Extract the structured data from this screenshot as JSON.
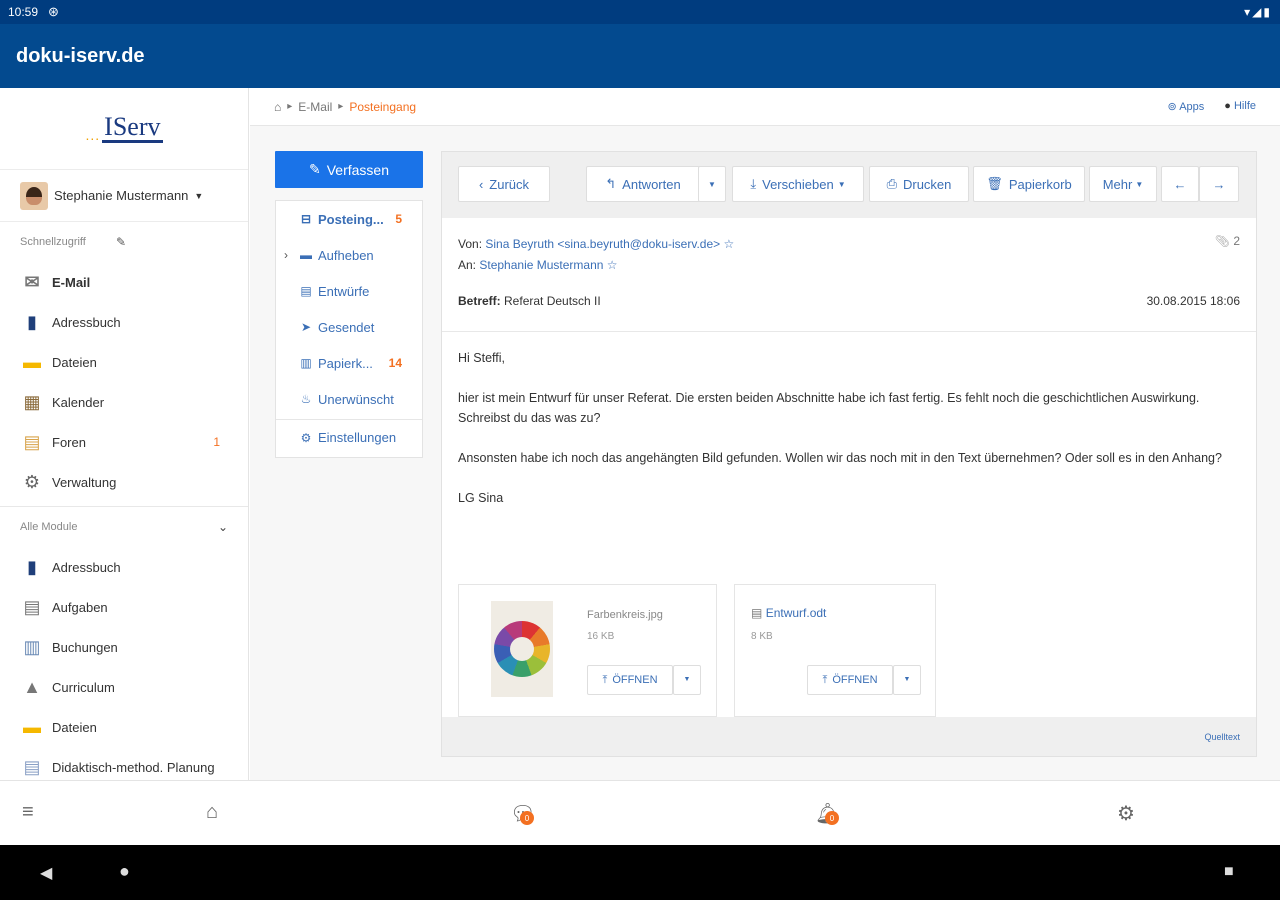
{
  "status_bar": {
    "time": "10:59",
    "signal_icons": "▾◢▮"
  },
  "app_bar": {
    "title": "doku-iserv.de"
  },
  "sidebar": {
    "logo_text": "IServ",
    "logo_dots": "...",
    "user_name": "Stephanie Mustermann",
    "quick_access_label": "Schnellzugriff",
    "quick_items": [
      {
        "label": "E-Mail",
        "icon": "envelope-icon"
      },
      {
        "label": "Adressbuch",
        "icon": "addressbook-icon"
      },
      {
        "label": "Dateien",
        "icon": "folder-icon"
      },
      {
        "label": "Kalender",
        "icon": "calendar-icon"
      },
      {
        "label": "Foren",
        "icon": "forum-icon",
        "badge": "1"
      },
      {
        "label": "Verwaltung",
        "icon": "gear-icon"
      }
    ],
    "all_modules_label": "Alle Module",
    "module_items": [
      {
        "label": "Adressbuch",
        "icon": "addressbook-icon"
      },
      {
        "label": "Aufgaben",
        "icon": "tasks-icon"
      },
      {
        "label": "Buchungen",
        "icon": "booking-icon"
      },
      {
        "label": "Curriculum",
        "icon": "curriculum-icon"
      },
      {
        "label": "Dateien",
        "icon": "folder-icon"
      },
      {
        "label": "Didaktisch-method. Planung",
        "icon": "document-icon"
      }
    ]
  },
  "breadcrumb": {
    "home": "home-icon",
    "email": "E-Mail",
    "current": "Posteingang",
    "apps": "Apps",
    "help": "Hilfe"
  },
  "compose_label": "Verfassen",
  "folders": [
    {
      "label": "Posteing...",
      "count": "5",
      "icon": "inbox-icon",
      "active": true
    },
    {
      "label": "Aufheben",
      "count": "",
      "icon": "folder-icon"
    },
    {
      "label": "Entwürfe",
      "count": "",
      "icon": "drafts-icon"
    },
    {
      "label": "Gesendet",
      "count": "",
      "icon": "sent-icon"
    },
    {
      "label": "Papierk...",
      "count": "14",
      "icon": "trash-icon"
    },
    {
      "label": "Unerwünscht",
      "count": "",
      "icon": "spam-icon"
    }
  ],
  "settings_label": "Einstellungen",
  "toolbar": {
    "back": "Zurück",
    "reply": "Antworten",
    "move": "Verschieben",
    "print": "Drucken",
    "trash": "Papierkorb",
    "more": "Mehr"
  },
  "mail": {
    "from_label": "Von:",
    "from": "Sina Beyruth <sina.beyruth@doku-iserv.de>",
    "to_label": "An:",
    "to": "Stephanie Mustermann",
    "attachment_count": "2",
    "subject_label": "Betreff:",
    "subject": "Referat Deutsch II",
    "date": "30.08.2015 18:06",
    "body": [
      "Hi Steffi,",
      "hier ist mein Entwurf für unser Referat. Die ersten beiden Abschnitte habe ich fast fertig. Es fehlt noch die geschichtlichen Auswirkung. Schreibst du das was zu?",
      "Ansonsten habe ich noch das angehängten Bild gefunden. Wollen wir das noch mit in den Text übernehmen? Oder soll es in den Anhang?",
      "LG Sina"
    ],
    "attachments": [
      {
        "name": "Farbenkreis.jpg",
        "size": "16 KB",
        "open": "ÖFFNEN"
      },
      {
        "name": "Entwurf.odt",
        "size": "8 KB",
        "open": "ÖFFNEN"
      }
    ],
    "source_link": "Quelltext"
  },
  "bottom_nav": {
    "chat_badge": "0",
    "notify_badge": "0"
  },
  "colors": {
    "app_bar": "#034a8f",
    "status_bar": "#003c7f",
    "accent": "#1a73e8",
    "link": "#3b6fb6",
    "badge": "#f37021"
  }
}
